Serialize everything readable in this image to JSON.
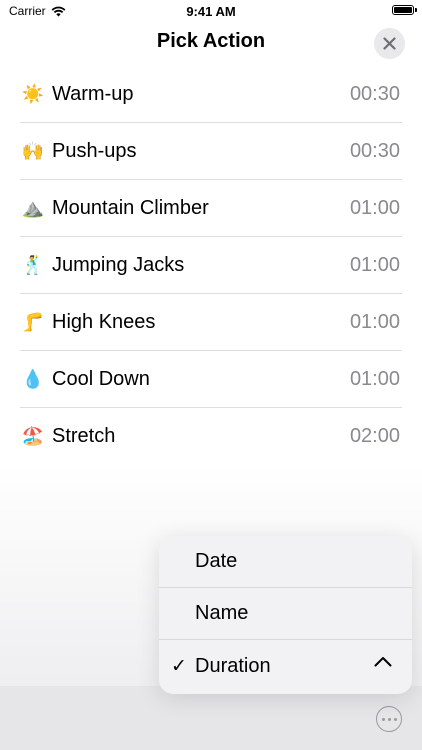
{
  "status": {
    "carrier": "Carrier",
    "time": "9:41 AM"
  },
  "header": {
    "title": "Pick Action",
    "close_icon": "close-icon"
  },
  "actions": [
    {
      "emoji": "☀️",
      "name": "Warm-up",
      "duration": "00:30"
    },
    {
      "emoji": "🙌",
      "name": "Push-ups",
      "duration": "00:30"
    },
    {
      "emoji": "⛰️",
      "name": "Mountain Climber",
      "duration": "01:00"
    },
    {
      "emoji": "🕺",
      "name": "Jumping Jacks",
      "duration": "01:00"
    },
    {
      "emoji": "🦵",
      "name": "High Knees",
      "duration": "01:00"
    },
    {
      "emoji": "💧",
      "name": "Cool Down",
      "duration": "01:00"
    },
    {
      "emoji": "🏖️",
      "name": "Stretch",
      "duration": "02:00"
    }
  ],
  "sort_menu": {
    "items": [
      {
        "label": "Date",
        "checked": false
      },
      {
        "label": "Name",
        "checked": false
      },
      {
        "label": "Duration",
        "checked": true,
        "direction": "ascending"
      }
    ],
    "check_mark": "✓"
  },
  "colors": {
    "secondary_text": "#8a8a8e",
    "separator": "#dedede",
    "menu_bg": "#f2f2f4"
  }
}
